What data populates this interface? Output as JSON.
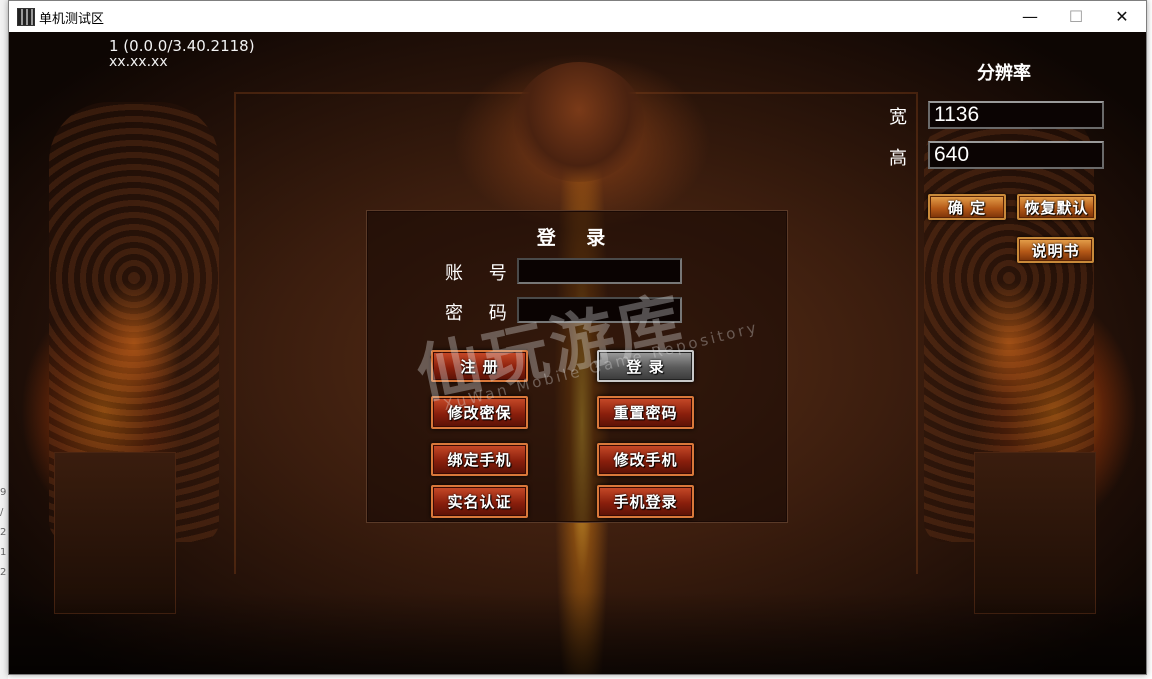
{
  "desktop": {
    "edge_glyphs": [
      "9",
      "/",
      "2",
      "1",
      "2"
    ]
  },
  "window": {
    "title": "单机测试区",
    "controls": {
      "minimize": "—",
      "maximize": "☐",
      "close": "✕"
    }
  },
  "game": {
    "version": "1 (0.0.0/3.40.2118)",
    "server": "xx.xx.xx",
    "resolution": {
      "title": "分辨率",
      "width_label": "宽",
      "width_value": "1136",
      "height_label": "高",
      "height_value": "640",
      "confirm": "确  定",
      "restore_default": "恢复默认",
      "manual": "说明书"
    },
    "login": {
      "title": "登 录",
      "account_label": "账 号",
      "password_label": "密 码",
      "account_value": "",
      "password_value": "",
      "buttons": {
        "register": "注  册",
        "login": "登  录",
        "modify_security": "修改密保",
        "reset_password": "重置密码",
        "bind_phone": "绑定手机",
        "modify_phone": "修改手机",
        "real_name": "实名认证",
        "phone_login": "手机登录"
      }
    },
    "watermark": {
      "main": "仙玩游库",
      "sub": "XuWan Mobile Game Repository"
    }
  }
}
